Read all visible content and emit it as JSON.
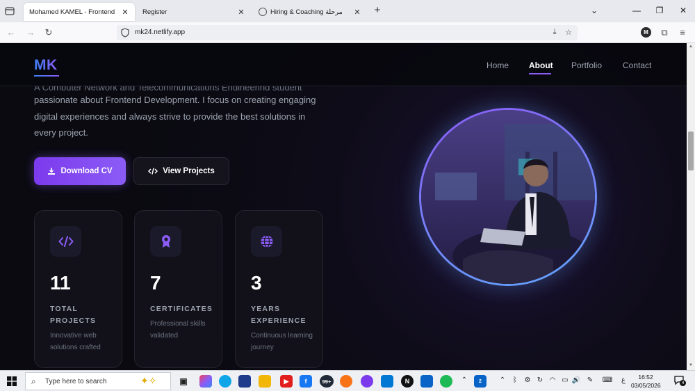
{
  "browser": {
    "tabs": [
      {
        "title": "Mohamed KAMEL - Frontend Devel",
        "active": true
      },
      {
        "title": "Register",
        "active": false
      },
      {
        "title": "Hiring & Coaching مرحلة",
        "active": false
      }
    ],
    "new_tab": "+",
    "url": "mk24.netlify.app",
    "profile_initial": "M"
  },
  "site": {
    "logo": "MK",
    "nav": [
      {
        "label": "Home",
        "active": false
      },
      {
        "label": "About",
        "active": true
      },
      {
        "label": "Portfolio",
        "active": false
      },
      {
        "label": "Contact",
        "active": false
      }
    ],
    "intro_cut": "A Computer Network and Telecommunications Engineering student",
    "intro": "passionate about Frontend Development. I focus on creating engaging digital experiences and always strive to provide the best solutions in every project.",
    "buttons": {
      "download": "Download CV",
      "projects": "View Projects"
    },
    "stats": [
      {
        "number": "11",
        "label": "TOTAL PROJECTS",
        "desc": "Innovative web solutions crafted",
        "icon": "code-icon"
      },
      {
        "number": "7",
        "label": "CERTIFICATES",
        "desc": "Professional skills validated",
        "icon": "award-icon"
      },
      {
        "number": "3",
        "label": "YEARS EXPERIENCE",
        "desc": "Continuous learning journey",
        "icon": "globe-icon"
      }
    ]
  },
  "taskbar": {
    "search_placeholder": "Type here to search",
    "badge_count": "99+",
    "mail_badge": "2",
    "lang": "ع",
    "time": "16:52",
    "date": "03/05/2026",
    "notif_count": "4"
  },
  "colors": {
    "accent": "#8b5cf6",
    "accent_blue": "#3b82f6"
  }
}
